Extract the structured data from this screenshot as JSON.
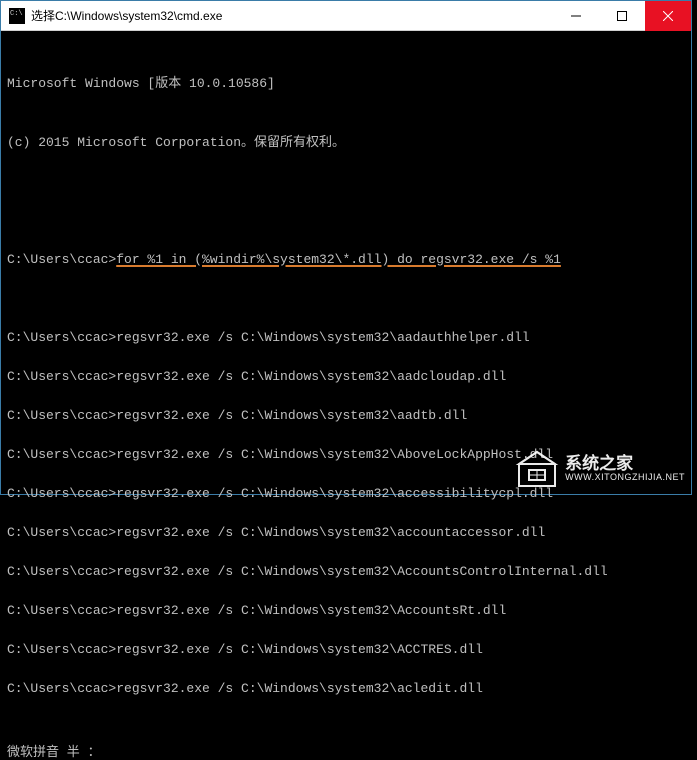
{
  "titlebar": {
    "text": "选择C:\\Windows\\system32\\cmd.exe"
  },
  "header": {
    "line1": "Microsoft Windows [版本 10.0.10586]",
    "line2": "(c) 2015 Microsoft Corporation。保留所有权利。"
  },
  "prompt": "C:\\Users\\ccac>",
  "command": "for %1 in (%windir%\\system32\\*.dll) do regsvr32.exe /s %1",
  "output_prefix": "regsvr32.exe /s C:\\Windows\\system32\\",
  "output_files": [
    "aadauthhelper.dll",
    "aadcloudap.dll",
    "aadtb.dll",
    "AboveLockAppHost.dll",
    "accessibilitycpl.dll",
    "accountaccessor.dll",
    "AccountsControlInternal.dll",
    "AccountsRt.dll",
    "ACCTRES.dll",
    "acledit.dll"
  ],
  "ime": "微软拼音 半 ：",
  "watermark": {
    "cn": "系统之家",
    "en": "WWW.XITONGZHIJIA.NET"
  }
}
